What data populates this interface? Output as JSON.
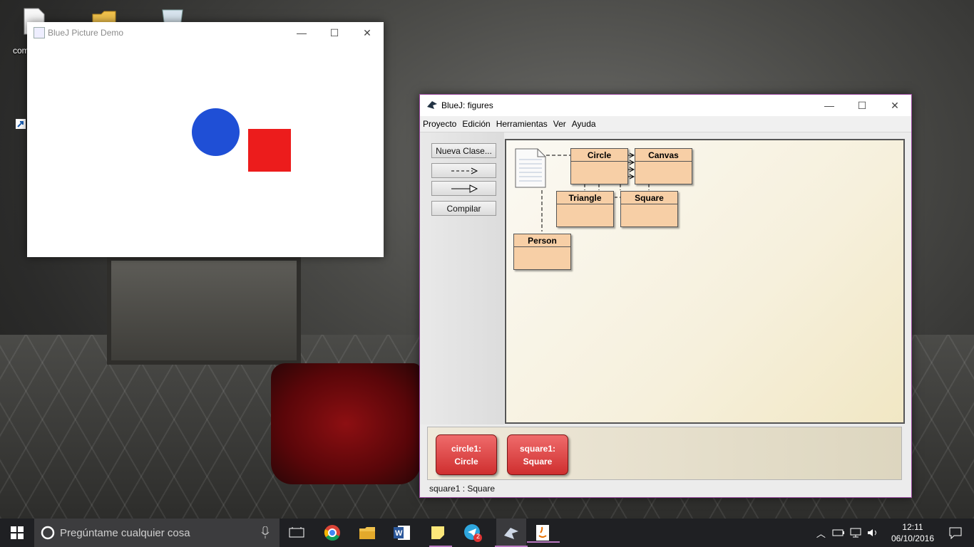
{
  "desktop": {
    "icon_label": "com"
  },
  "picture_window": {
    "title": "BlueJ Picture Demo",
    "minimize": "—",
    "maximize": "☐",
    "close": "✕"
  },
  "bluej_window": {
    "title": "BlueJ:  figures",
    "minimize": "—",
    "maximize": "☐",
    "close": "✕",
    "menu": [
      "Proyecto",
      "Edición",
      "Herramientas",
      "Ver",
      "Ayuda"
    ],
    "tools": {
      "new_class": "Nueva Clase...",
      "dependency_arrow": "- - ->",
      "inheritance_arrow": "——▷",
      "compile": "Compilar"
    },
    "classes": [
      "Circle",
      "Canvas",
      "Triangle",
      "Square",
      "Person"
    ],
    "objects": [
      {
        "line1": "circle1:",
        "line2": "Circle"
      },
      {
        "line1": "square1:",
        "line2": "Square"
      }
    ],
    "status": "square1 : Square"
  },
  "taskbar": {
    "search_placeholder": "Pregúntame cualquier cosa",
    "telegram_badge": "2",
    "time": "12:11",
    "date": "06/10/2016"
  }
}
